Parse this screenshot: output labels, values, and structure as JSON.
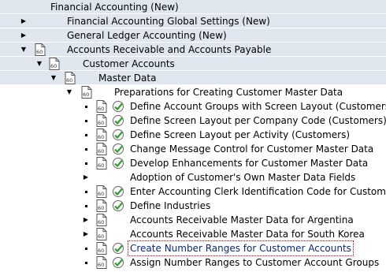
{
  "tree": {
    "items": [
      {
        "label": "Financial Accounting (New)"
      },
      {
        "label": "Financial Accounting Global Settings (New)"
      },
      {
        "label": "General Ledger Accounting (New)"
      },
      {
        "label": "Accounts Receivable and Accounts Payable"
      },
      {
        "label": "Customer Accounts"
      },
      {
        "label": "Master Data"
      },
      {
        "label": "Preparations for Creating Customer Master Data"
      },
      {
        "label": "Define Account Groups with Screen Layout (Customers)"
      },
      {
        "label": "Define Screen Layout per Company Code (Customers)"
      },
      {
        "label": "Define Screen Layout per Activity (Customers)"
      },
      {
        "label": "Change Message Control for Customer Master Data"
      },
      {
        "label": "Develop Enhancements for Customer Master Data"
      },
      {
        "label": "Adoption of Customer's Own Master Data Fields"
      },
      {
        "label": "Enter Accounting Clerk Identification Code for Customers"
      },
      {
        "label": "Define Industries"
      },
      {
        "label": "Accounts Receivable Master Data for Argentina"
      },
      {
        "label": "Accounts Receivable Master Data for South Korea"
      },
      {
        "label": "Create Number Ranges for Customer Accounts"
      },
      {
        "label": "Assign Number Ranges to Customer Account Groups"
      }
    ]
  },
  "colors": {
    "band": "#dfe6ee",
    "check_green": "#2f9e2f",
    "focus_text": "#0a2a7a",
    "focus_outline": "#b00000"
  }
}
